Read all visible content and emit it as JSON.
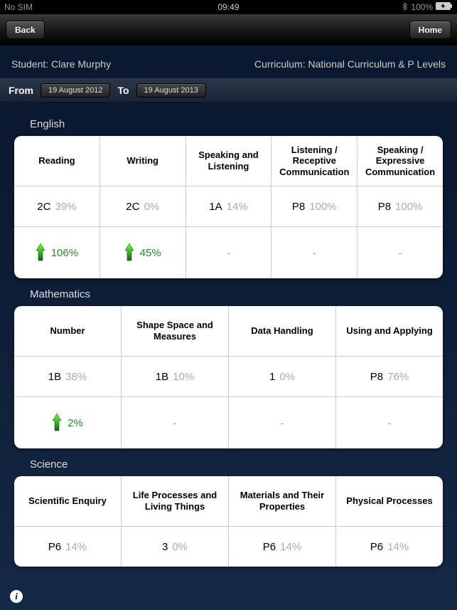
{
  "status": {
    "left": "No SIM",
    "time": "09:49",
    "battery": "100%"
  },
  "nav": {
    "back": "Back",
    "home": "Home"
  },
  "header": {
    "student_label": "Student: Clare Murphy",
    "curriculum_label": "Curriculum: National Curriculum & P Levels"
  },
  "dates": {
    "from_lbl": "From",
    "from": "19 August 2012",
    "to_lbl": "To",
    "to": "19 August 2013"
  },
  "sections": {
    "english": {
      "title": "English",
      "cols": [
        {
          "name": "Reading",
          "level": "2C",
          "pct": "39%",
          "progress": "106%"
        },
        {
          "name": "Writing",
          "level": "2C",
          "pct": "0%",
          "progress": "45%"
        },
        {
          "name": "Speaking and Listening",
          "level": "1A",
          "pct": "14%",
          "progress": "-"
        },
        {
          "name": "Listening / Receptive Communication",
          "level": "P8",
          "pct": "100%",
          "progress": "-"
        },
        {
          "name": "Speaking / Expressive Communication",
          "level": "P8",
          "pct": "100%",
          "progress": "-"
        }
      ]
    },
    "maths": {
      "title": "Mathematics",
      "cols": [
        {
          "name": "Number",
          "level": "1B",
          "pct": "38%",
          "progress": "2%"
        },
        {
          "name": "Shape Space and Measures",
          "level": "1B",
          "pct": "10%",
          "progress": "-"
        },
        {
          "name": "Data Handling",
          "level": "1",
          "pct": "0%",
          "progress": "-"
        },
        {
          "name": "Using and Applying",
          "level": "P8",
          "pct": "76%",
          "progress": "-"
        }
      ]
    },
    "science": {
      "title": "Science",
      "cols": [
        {
          "name": "Scientific Enquiry",
          "level": "P6",
          "pct": "14%"
        },
        {
          "name": "Life Processes and Living Things",
          "level": "3",
          "pct": "0%"
        },
        {
          "name": "Materials and Their Properties",
          "level": "P6",
          "pct": "14%"
        },
        {
          "name": "Physical Processes",
          "level": "P6",
          "pct": "14%"
        }
      ]
    }
  }
}
